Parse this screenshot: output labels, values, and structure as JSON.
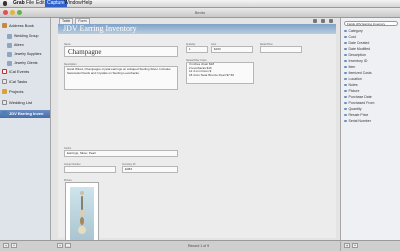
{
  "menu": {
    "app": "Grab",
    "file": "File",
    "edit": "Edit",
    "capture": "Capture",
    "window": "Window",
    "help": "Help"
  },
  "window": {
    "title": "Bento"
  },
  "sidebar": {
    "items": [
      {
        "label": "Address Book"
      },
      {
        "label": "Wedding Group"
      },
      {
        "label": "Aileen"
      },
      {
        "label": "Jewelry Suppliers"
      },
      {
        "label": "Jewelry Clients"
      },
      {
        "label": "iCal Events"
      },
      {
        "label": "iCal Tasks"
      },
      {
        "label": "Projects"
      },
      {
        "label": "Wedding List"
      },
      {
        "label": "JDV Earring Inven"
      }
    ]
  },
  "tabs": [
    "Table",
    "Form"
  ],
  "header": {
    "title": "JDV Earring Inventory"
  },
  "form": {
    "name_label": "Name",
    "name_value": "Champagne",
    "quantity_label": "Quantity",
    "quantity_value": "1",
    "cost_label": "Cost",
    "cost_value": "$150",
    "retail_label": "Retail Price",
    "retail_value": "",
    "description_label": "Description",
    "description_value": "Hand Wired, Champagne crystal earrings on antiqued Sterling Silver. Includes Swarovski Pearls and Crystals on Sterling Leverbacks.",
    "notes_label": "Notes/Other Costs",
    "notes_lines": [
      "3 inches chain $18",
      "2 leverbacks $16",
      "12 4 mm bicon $",
      "18 4mm Swar Bronze Pearl $7.50"
    ],
    "colors_label": "Colors",
    "colors_value": "Earrings, Silver, Pearl",
    "group_label": "Group Number",
    "group_value": "",
    "inventory_label": "Inventory ID",
    "inventory_value": "E083",
    "picture_label": "Picture"
  },
  "status": {
    "record_text": "Record 1 of 9"
  },
  "rightpanel": {
    "search_value": "Fields JDV Earring Inventory",
    "fields": [
      "Category",
      "Cost",
      "Date Created",
      "Date Modified",
      "Description",
      "Inventory ID",
      "Item",
      "Itemized Costs",
      "Location",
      "Notes",
      "Picture",
      "Purchase Date",
      "Purchased From",
      "Quantity",
      "Resale Price",
      "Serial Number"
    ]
  },
  "colors": {
    "header_accent": "#7fa2c7",
    "selection": "#466ea8"
  },
  "icons": [
    "apple-icon",
    "close-icon",
    "minimize-icon",
    "zoom-icon",
    "book-icon",
    "folder-icon",
    "grid-icon",
    "gear-icon",
    "search-icon",
    "plus-icon",
    "minus-icon"
  ]
}
